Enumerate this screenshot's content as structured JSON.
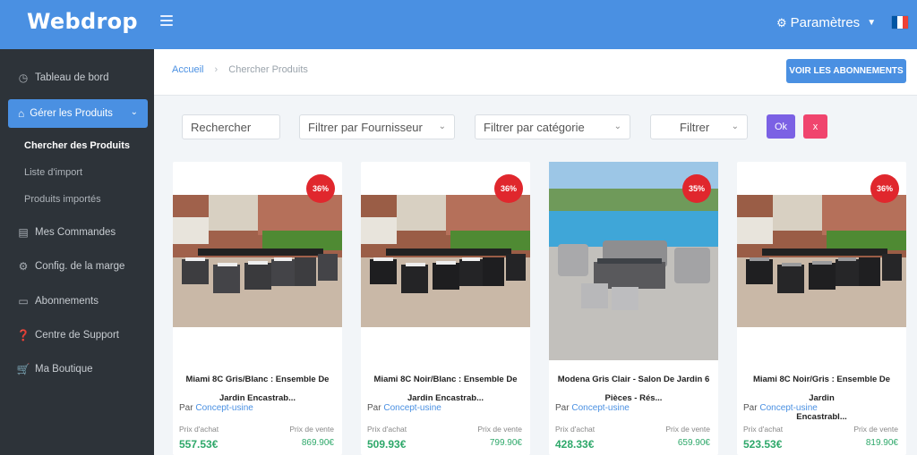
{
  "header": {
    "brand": "Webdrop",
    "settings_label": "Paramètres",
    "flag_colors": [
      "#0055a4",
      "#ffffff",
      "#ef4135"
    ]
  },
  "sidebar": {
    "items": [
      {
        "label": "Tableau de bord",
        "icon": "dashboard-icon"
      },
      {
        "label": "Gérer les Produits",
        "icon": "home-icon"
      },
      {
        "label": "Mes Commandes",
        "icon": "list-icon"
      },
      {
        "label": "Config. de la marge",
        "icon": "gear-icon"
      },
      {
        "label": "Abonnements",
        "icon": "credit-card-icon"
      },
      {
        "label": "Centre de Support",
        "icon": "help-icon"
      },
      {
        "label": "Ma Boutique",
        "icon": "cart-icon"
      }
    ],
    "subitems": [
      {
        "label": "Chercher des Produits"
      },
      {
        "label": "Liste d'import"
      },
      {
        "label": "Produits importés"
      }
    ]
  },
  "breadcrumb": {
    "home": "Accueil",
    "current": "Chercher Produits"
  },
  "subscriptions_button": "VOIR LES ABONNEMENTS",
  "filters": {
    "search_placeholder": "Rechercher",
    "supplier": "Filtrer par Fournisseur",
    "category": "Filtrer par catégorie",
    "filter": "Filtrer",
    "ok": "Ok",
    "clear": "x"
  },
  "products": [
    {
      "badge": "36%",
      "title_1": "Miami 8C Gris/Blanc : Ensemble De",
      "title_2": "Jardin Encastrab...",
      "by": "Par",
      "vendor": "Concept-usine",
      "buy_label": "Prix d'achat",
      "sell_label": "Prix de vente",
      "buy_price": "557.53€",
      "sell_price": "869.90€"
    },
    {
      "badge": "36%",
      "title_1": "Miami 8C Noir/Blanc : Ensemble De",
      "title_2": "Jardin Encastrab...",
      "by": "Par",
      "vendor": "Concept-usine",
      "buy_label": "Prix d'achat",
      "sell_label": "Prix de vente",
      "buy_price": "509.93€",
      "sell_price": "799.90€"
    },
    {
      "badge": "35%",
      "title_1": "Modena Gris Clair - Salon De Jardin 6",
      "title_2": "Pièces - Rés...",
      "by": "Par",
      "vendor": "Concept-usine",
      "buy_label": "Prix d'achat",
      "sell_label": "Prix de vente",
      "buy_price": "428.33€",
      "sell_price": "659.90€"
    },
    {
      "badge": "36%",
      "title_1": "Miami 8C Noir/Gris : Ensemble De Jardin",
      "title_2": "Encastrabl...",
      "by": "Par",
      "vendor": "Concept-usine",
      "buy_label": "Prix d'achat",
      "sell_label": "Prix de vente",
      "buy_price": "523.53€",
      "sell_price": "819.90€"
    }
  ]
}
